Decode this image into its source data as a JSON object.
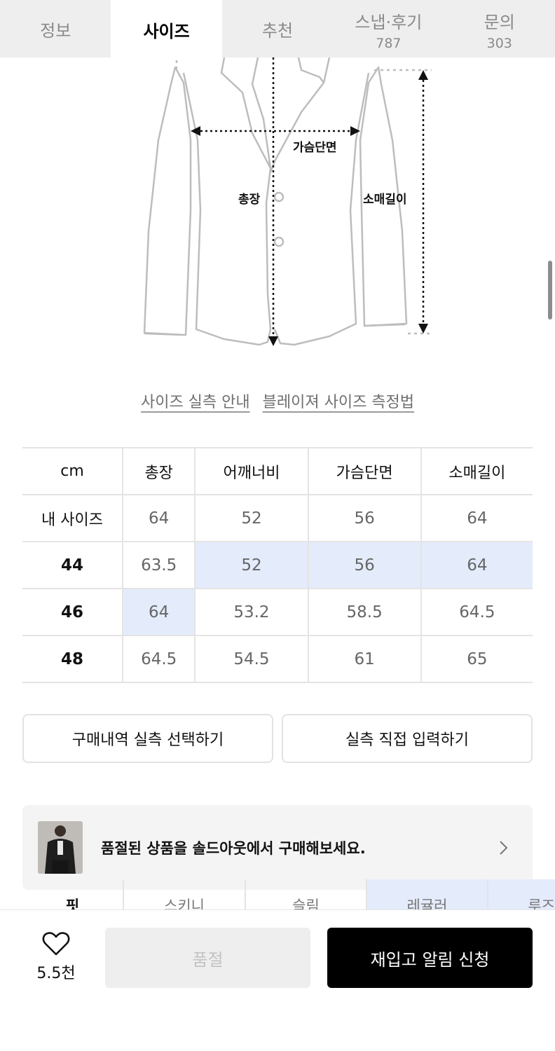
{
  "tabs": [
    {
      "label": "정보",
      "count": null
    },
    {
      "label": "사이즈",
      "count": null
    },
    {
      "label": "추천",
      "count": null
    },
    {
      "label": "스냅·후기",
      "count": "787"
    },
    {
      "label": "문의",
      "count": "303"
    }
  ],
  "active_tab": "사이즈",
  "diagram": {
    "labels": {
      "chest": "가슴단면",
      "length": "총장",
      "sleeve": "소매길이"
    }
  },
  "guides": {
    "size_guide": "사이즈 실측 안내",
    "measure_guide": "블레이져 사이즈 측정법"
  },
  "size_table": {
    "headers": [
      "cm",
      "총장",
      "어깨너비",
      "가슴단면",
      "소매길이"
    ],
    "rows": [
      {
        "label": "내 사이즈",
        "values": [
          "64",
          "52",
          "56",
          "64"
        ]
      },
      {
        "label": "44",
        "values": [
          "63.5",
          "52",
          "56",
          "64"
        ]
      },
      {
        "label": "46",
        "values": [
          "64",
          "53.2",
          "58.5",
          "64.5"
        ]
      },
      {
        "label": "48",
        "values": [
          "64.5",
          "54.5",
          "61",
          "65"
        ]
      }
    ]
  },
  "buttons": {
    "purchase_history": "구매내역 실측 선택하기",
    "direct_input": "실측 직접 입력하기"
  },
  "banner": {
    "text": "품절된 상품을 솔드아웃에서 구매해보세요."
  },
  "fit": {
    "label": "핏",
    "options": [
      "스키니",
      "슬림",
      "레귤러",
      "루즈"
    ],
    "selected": "레귤러"
  },
  "bottom_bar": {
    "like_count": "5.5천",
    "soldout_label": "품절",
    "notify_label": "재입고 알림 신청"
  },
  "colors": {
    "highlight": "#e4ebfb",
    "primary": "#000000"
  }
}
